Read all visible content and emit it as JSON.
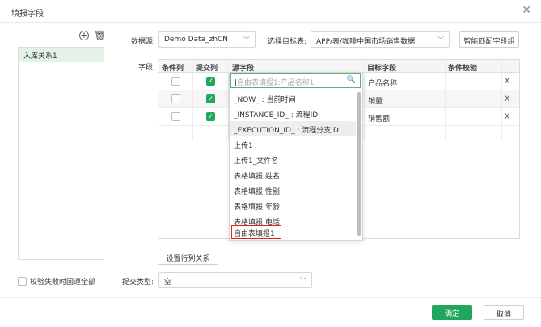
{
  "dialog": {
    "title": "填报字段",
    "close_icon": "close-icon"
  },
  "left_panel": {
    "add_icon": "plus-circle-icon",
    "delete_icon": "trash-icon",
    "items": [
      {
        "label": "入库关系1"
      }
    ]
  },
  "form": {
    "datasource_label": "数据源:",
    "datasource_value": "Demo Data_zhCN",
    "target_label": "选择目标表:",
    "target_value": "APP/表/咖啡中国市场销售数据",
    "smart_match_button": "智能匹配字段组",
    "fields_label": "字段:"
  },
  "table": {
    "columns": [
      "条件列",
      "提交列",
      "源字段",
      "目标字段",
      "条件校验"
    ],
    "rows": [
      {
        "condition": false,
        "submit": true,
        "source": "",
        "target": "产品名称",
        "delete": "X"
      },
      {
        "condition": false,
        "submit": true,
        "source": "",
        "target": "销量",
        "delete": "X"
      },
      {
        "condition": false,
        "submit": true,
        "source": "",
        "target": "销售额",
        "delete": "X"
      }
    ],
    "set_row_relation_button": "设置行列关系"
  },
  "dropdown": {
    "search_placeholder": "自由表填报1:产品名称1",
    "options": [
      "_NOW_ : 当前时间",
      "_INSTANCE_ID_ : 流程ID",
      "_EXECUTION_ID_ : 流程分支ID",
      "上传1",
      "上传1_文件名",
      "表格填报:姓名",
      "表格填报:性别",
      "表格填报:年龄",
      "表格填报:电话",
      "自由表填报1"
    ],
    "hovered_index": 2,
    "highlighted_index": 9
  },
  "footer": {
    "rollback_label": "校验失败时回退全部",
    "submit_type_label": "提交类型:",
    "submit_type_value": "空",
    "ok_button": "确定",
    "cancel_button": "取消"
  },
  "colors": {
    "accent": "#21a75c",
    "highlight": "#e02020",
    "selected_item_bg": "#e3f2e7"
  }
}
